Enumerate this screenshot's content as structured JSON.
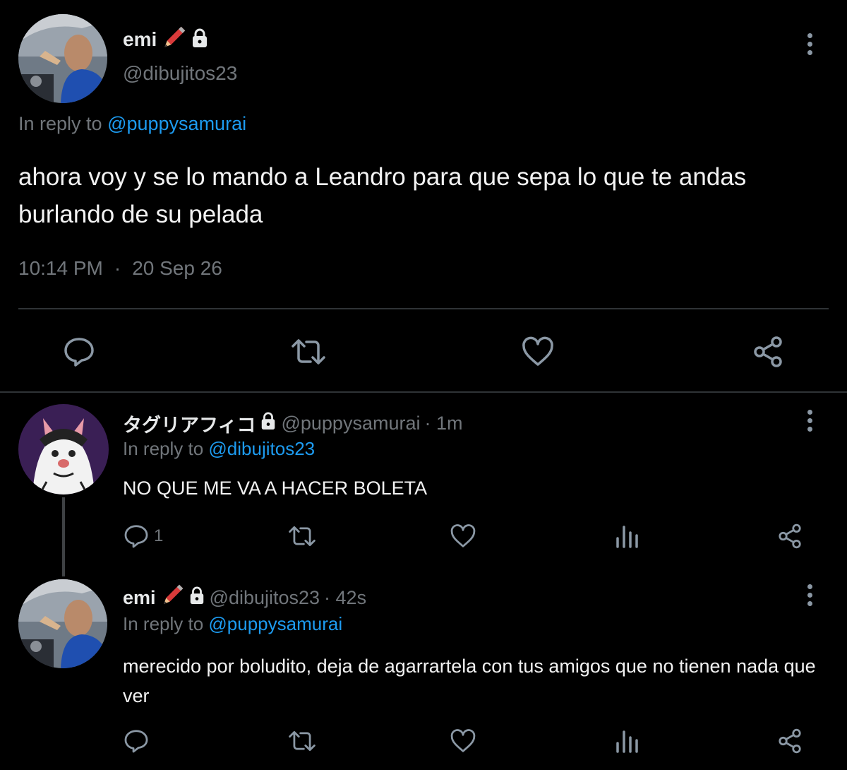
{
  "main_tweet": {
    "display_name": "emi",
    "handle": "@dibujitos23",
    "reply_prefix": "In reply to",
    "reply_to": "@puppysamurai",
    "text": "ahora voy y se lo mando a Leandro para que sepa lo que te andas burlando de su pelada",
    "time": "10:14 PM",
    "separator": "·",
    "date": "20 Sep 26",
    "badge_icons": [
      "pencil-emoji",
      "lock-icon"
    ],
    "actions": [
      "reply-icon",
      "retweet-icon",
      "like-icon",
      "share-icon"
    ]
  },
  "replies": [
    {
      "display_name": "タグリアフィコ",
      "handle": "@puppysamurai",
      "meta": "· 1m",
      "reply_prefix": "In reply to",
      "reply_to": "@dibujitos23",
      "text": "NO QUE ME VA A HACER BOLETA",
      "reply_count": "1",
      "badge_icons": [
        "lock-icon"
      ]
    },
    {
      "display_name": "emi",
      "handle": "@dibujitos23",
      "meta": "· 42s",
      "reply_prefix": "In reply to",
      "reply_to": "@puppysamurai",
      "text": "merecido por boludito, deja de agarrartela con tus amigos que no tienen nada que ver",
      "reply_count": "",
      "badge_icons": [
        "pencil-emoji",
        "lock-icon"
      ]
    }
  ],
  "colors": {
    "background": "#000000",
    "text": "#e7e9ea",
    "secondary": "#71767b",
    "link": "#1d9bf0",
    "divider": "#2f3336"
  }
}
